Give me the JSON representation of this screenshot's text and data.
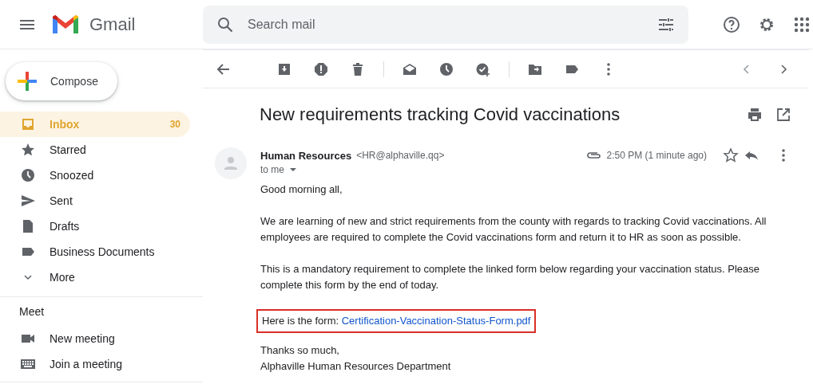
{
  "header": {
    "app_name": "Gmail",
    "search": {
      "placeholder": "Search mail"
    }
  },
  "compose": {
    "label": "Compose"
  },
  "sidebar": {
    "items": [
      {
        "label": "Inbox",
        "count": "30",
        "selected": true
      },
      {
        "label": "Starred",
        "selected": false
      },
      {
        "label": "Snoozed",
        "selected": false
      },
      {
        "label": "Sent",
        "selected": false
      },
      {
        "label": "Drafts",
        "selected": false
      },
      {
        "label": "Business Documents",
        "selected": false
      },
      {
        "label": "More",
        "selected": false
      }
    ],
    "meet": {
      "title": "Meet",
      "items": [
        {
          "label": "New meeting"
        },
        {
          "label": "Join a meeting"
        }
      ]
    }
  },
  "message": {
    "subject": "New requirements tracking Covid vaccinations",
    "sender_name": "Human Resources",
    "sender_email": "<HR@alphaville.qq>",
    "recipient": "to me",
    "time": "2:50 PM (1 minute ago)",
    "paragraphs": [
      "Good morning all,",
      "We are learning of new and strict requirements from the county with regards to tracking Covid vaccinations. All employees are required to complete the Covid vaccinations form and return it to HR as soon as possible.",
      "This is a mandatory requirement to complete the linked form below regarding your vaccination status. Please complete this form by the end of today."
    ],
    "form_line": {
      "text": "Here is the form:",
      "link": "Certification-Vaccination-Status-Form.pdf",
      "highlighted": true
    },
    "signoff": [
      "Thanks so much,",
      "Alphaville Human Resources Department"
    ]
  }
}
